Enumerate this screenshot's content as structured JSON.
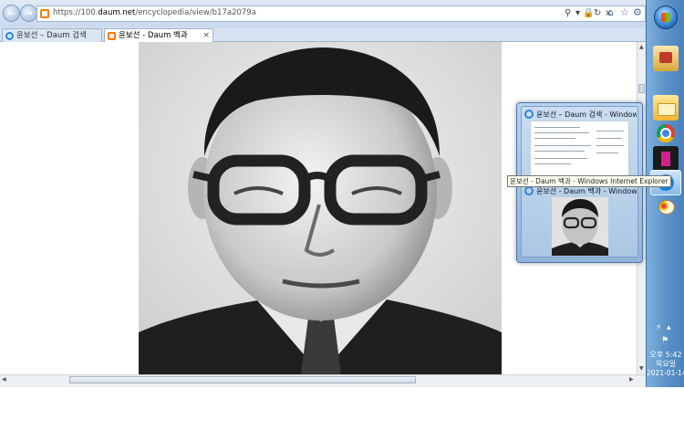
{
  "window": {
    "url_prefix": "https://100.",
    "url_domain": "daum.net",
    "url_path": "/encyclopedia/view/b17a2079a",
    "tabs": [
      {
        "label": "윤보선 – Daum 검색",
        "icon": "ie-icon"
      },
      {
        "label": "윤보선 - Daum 백과",
        "icon": "daum-icon",
        "active": true
      }
    ]
  },
  "taskbar": {
    "clock_time": "오후 5:42",
    "clock_day": "목요일",
    "clock_date": "2021-01-14"
  },
  "thumbnails": [
    {
      "title": "윤보선 – Daum 검색 - Window..."
    },
    {
      "title": "윤보선 - Daum 백과 - Window..."
    }
  ],
  "tooltip": "윤보선 - Daum 백과 - Windows Internet Explorer",
  "colors": {
    "taskbar": "#5c93c8",
    "accent": "#2f86d6",
    "daum": "#ff7b00"
  }
}
